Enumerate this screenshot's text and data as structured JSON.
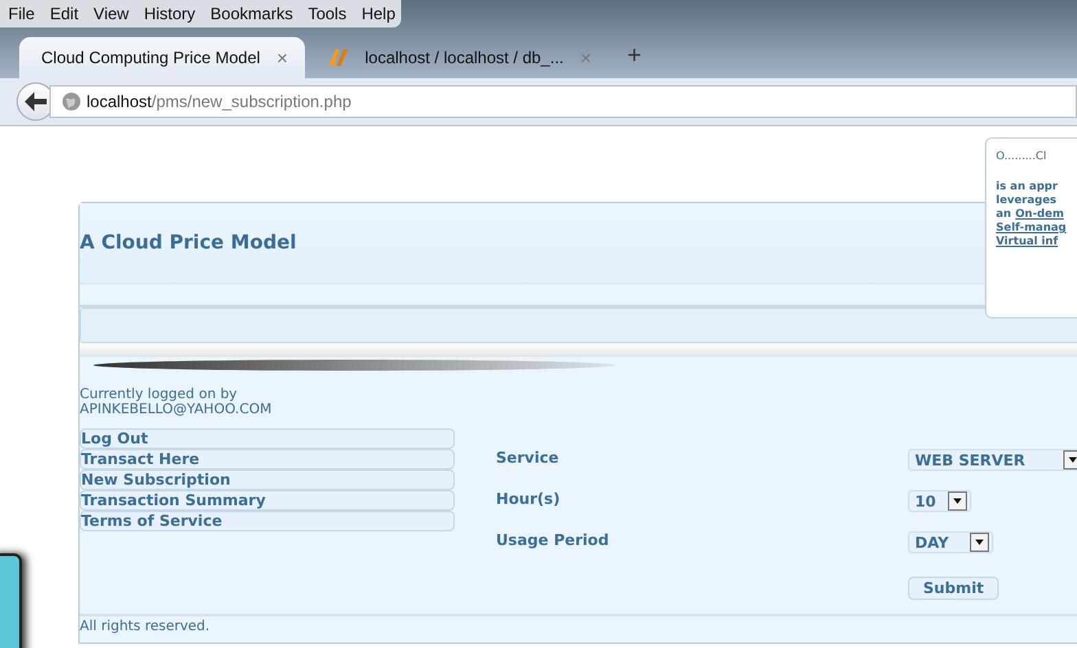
{
  "menu_bar": [
    "File",
    "Edit",
    "View",
    "History",
    "Bookmarks",
    "Tools",
    "Help"
  ],
  "tabs": [
    {
      "title": "Cloud Computing Price Model",
      "selected": true,
      "close": "×"
    },
    {
      "title": "localhost / localhost / db_...",
      "selected": false,
      "close": "×"
    }
  ],
  "new_tab": "+",
  "address": {
    "host": "localhost",
    "path": "/pms/new_subscription.php"
  },
  "site": {
    "title": "A Cloud Price Model",
    "login_label": "Currently logged on by",
    "user": "APINKEBELLO@YAHOO.COM",
    "nav": [
      "Log Out",
      "Transact Here",
      "New Subscription",
      "Transaction Summary",
      "Terms of Service"
    ],
    "form": [
      {
        "label": "Service",
        "value": "WEB SERVER"
      },
      {
        "label": "Hour(s)",
        "value": "10"
      },
      {
        "label": "Usage Period",
        "value": "DAY"
      }
    ],
    "submit": "Submit",
    "footer": "All rights reserved."
  },
  "popup": {
    "heading": "O.........Cl",
    "lines": [
      [
        {
          "text": "is an appr",
          "link": false
        }
      ],
      [
        {
          "text": "leverages",
          "link": false
        }
      ],
      [
        {
          "text": "an",
          "link": false
        },
        {
          "text": "On-dem",
          "link": true
        }
      ],
      [
        {
          "text": "Self-manag",
          "link": true
        }
      ],
      [
        {
          "text": "Virtual inf",
          "link": true
        }
      ]
    ]
  }
}
